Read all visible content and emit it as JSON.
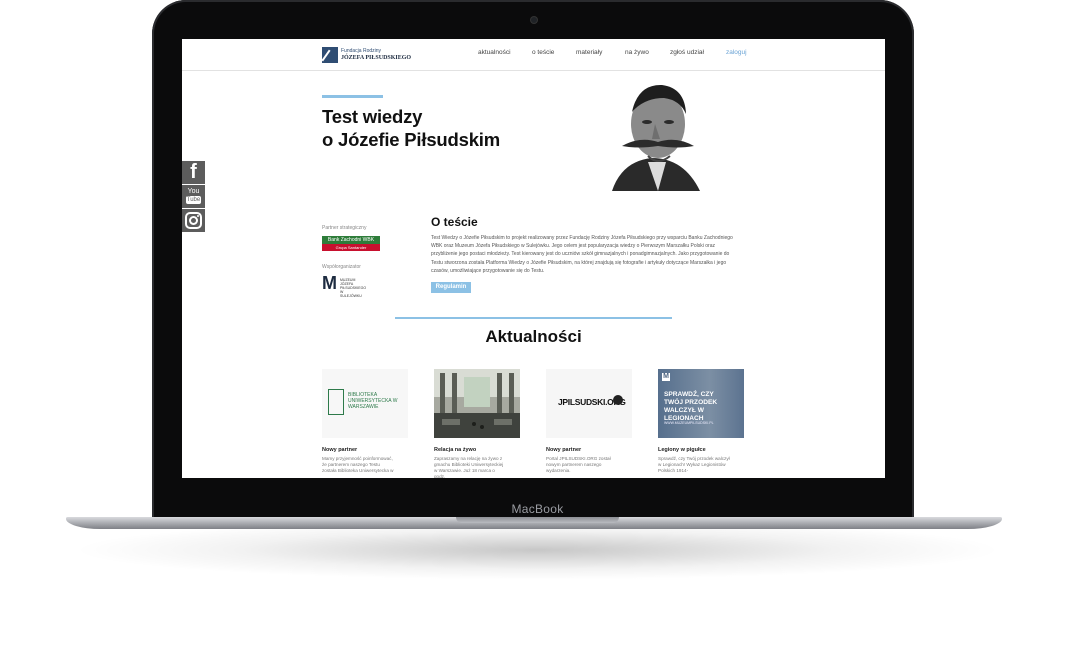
{
  "device": {
    "label": "MacBook"
  },
  "site": {
    "logo": {
      "line1": "Fundacja Rodziny",
      "line2": "JÓZEFA PIŁSUDSKIEGO"
    },
    "nav": [
      "aktualności",
      "o teście",
      "materiały",
      "na żywo",
      "zgłoś udział",
      "zaloguj"
    ],
    "nav_active_index": 5,
    "hero": {
      "title_line1": "Test wiedzy",
      "title_line2": "o Józefie Piłsudskim"
    },
    "social": [
      "facebook-icon",
      "youtube-icon",
      "instagram-icon"
    ],
    "social_youtube": {
      "line1": "You",
      "line2": "Tube"
    },
    "partners": {
      "strategic_label": "Partner strategiczny",
      "strategic_logo_line1": "Bank Zachodni WBK",
      "strategic_logo_line2": "Grupa Santander",
      "coorganizer_label": "Współorganizator",
      "coorganizer_logo_line1": "MUZEUM JÓZEFA PIŁSUDSKIEGO",
      "coorganizer_logo_line2": "W SULEJÓWKU"
    },
    "about": {
      "title": "O teście",
      "text": "Test Wiedzy o Józefie Piłsudskim to projekt realizowany przez Fundację Rodziny Józefa Piłsudskiego przy wsparciu Banku Zachodniego WBK oraz Muzeum Józefa Piłsudskiego w Sulejówku. Jego celem jest popularyzacja wiedzy o Pierwszym Marszałku Polski oraz przybliżenie jego postaci młodzieży. Test kierowany jest do uczniów szkół gimnazjalnych i ponadgimnazjalnych. Jako przygotowanie do Testu stworzona została Platforma Wiedzy o Józefie Piłsudskim, na której znajdują się fotografie i artykuły dotyczące Marszałka i jego czasów, umożliwiające przygotowanie się do Testu.",
      "button": "Regulamin"
    },
    "news": {
      "heading": "Aktualności",
      "items": [
        {
          "title": "Nowy partner",
          "text": "Mamy przyjemność poinformować, że partnerem naszego Testu została Biblioteka Uniwersytecka w",
          "image_text": "BIBLIOTEKA UNIWERSYTECKA W WARSZAWIE"
        },
        {
          "title": "Relacja na żywo",
          "text": "Zapraszamy na relację na żywo z gmachu Biblioteki Uniwersyteckiej w Warszawie. Już 18 marca o godz.",
          "image_text": ""
        },
        {
          "title": "Nowy partner",
          "text": "Portal JPILSUDSKI.ORG został nowym partnerem naszego wydarzenia.",
          "image_text": "JPILSUDSKI.ORG"
        },
        {
          "title": "Legiony w pigułce",
          "text": "Sprawdź, czy Twój przodek walczył w Legionach! Wykaz Legionistów Polskich 1914-",
          "image_text": "SPRAWDŹ, CZY TWÓJ PRZODEK WALCZYŁ W LEGIONACH",
          "image_subtext": "WWW.MUZEUMPILSUDSKI.PL"
        }
      ]
    },
    "colors": {
      "accent": "#8cc1e5",
      "text": "#111111",
      "social_bg": "#5c5c5c"
    }
  }
}
